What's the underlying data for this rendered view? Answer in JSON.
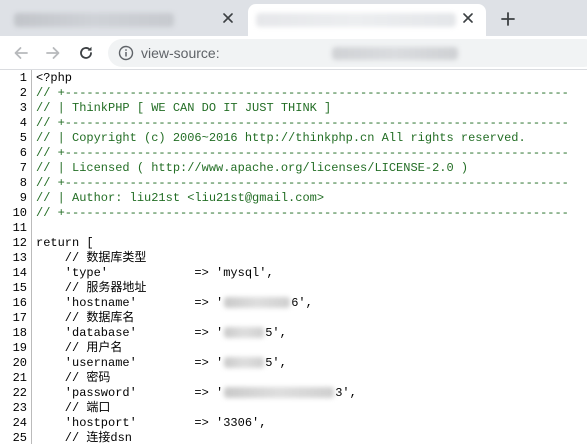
{
  "tabs": [
    {
      "title": "",
      "active": false
    },
    {
      "title": "",
      "active": true
    }
  ],
  "new_tab_symbol": "+",
  "close_symbol": "✕",
  "address_bar": {
    "url_visible": "view-source:"
  },
  "icons": {
    "back": "back-arrow-icon",
    "forward": "forward-arrow-icon",
    "reload": "reload-icon",
    "info": "info-icon"
  },
  "colors": {
    "comment": "#236e25",
    "text": "#000000",
    "tabbar": "#dee1e6",
    "omnibox": "#f1f3f4"
  },
  "source_lines": [
    {
      "num": "1",
      "comment": false,
      "segs": [
        "<?php"
      ]
    },
    {
      "num": "2",
      "comment": true,
      "segs": [
        "// +----------------------------------------------------------------------"
      ]
    },
    {
      "num": "3",
      "comment": true,
      "segs": [
        "// | ThinkPHP [ WE CAN DO IT JUST THINK ]"
      ]
    },
    {
      "num": "4",
      "comment": true,
      "segs": [
        "// +----------------------------------------------------------------------"
      ]
    },
    {
      "num": "5",
      "comment": true,
      "segs": [
        "// | Copyright (c) 2006~2016 http://thinkphp.cn All rights reserved."
      ]
    },
    {
      "num": "6",
      "comment": true,
      "segs": [
        "// +----------------------------------------------------------------------"
      ]
    },
    {
      "num": "7",
      "comment": true,
      "segs": [
        "// | Licensed ( http://www.apache.org/licenses/LICENSE-2.0 )"
      ]
    },
    {
      "num": "8",
      "comment": true,
      "segs": [
        "// +----------------------------------------------------------------------"
      ]
    },
    {
      "num": "9",
      "comment": true,
      "segs": [
        "// | Author: liu21st <liu21st@gmail.com>"
      ]
    },
    {
      "num": "10",
      "comment": true,
      "segs": [
        "// +----------------------------------------------------------------------"
      ]
    },
    {
      "num": "11",
      "comment": false,
      "segs": [
        ""
      ]
    },
    {
      "num": "12",
      "comment": false,
      "segs": [
        "return ["
      ]
    },
    {
      "num": "13",
      "comment": false,
      "segs": [
        "    // 数据库类型"
      ]
    },
    {
      "num": "14",
      "comment": false,
      "segs": [
        "    'type'            => 'mysql',"
      ]
    },
    {
      "num": "15",
      "comment": false,
      "segs": [
        "    // 服务器地址"
      ]
    },
    {
      "num": "16",
      "comment": false,
      "segs": [
        "    'hostname'        => '",
        {
          "redact": 66
        },
        "6',"
      ]
    },
    {
      "num": "17",
      "comment": false,
      "segs": [
        "    // 数据库名"
      ]
    },
    {
      "num": "18",
      "comment": false,
      "segs": [
        "    'database'        => '",
        {
          "redact": 40
        },
        "5',"
      ]
    },
    {
      "num": "19",
      "comment": false,
      "segs": [
        "    // 用户名"
      ]
    },
    {
      "num": "20",
      "comment": false,
      "segs": [
        "    'username'        => '",
        {
          "redact": 40
        },
        "5',"
      ]
    },
    {
      "num": "21",
      "comment": false,
      "segs": [
        "    // 密码"
      ]
    },
    {
      "num": "22",
      "comment": false,
      "segs": [
        "    'password'        => '",
        {
          "redact": 110
        },
        "3',"
      ]
    },
    {
      "num": "23",
      "comment": false,
      "segs": [
        "    // 端口"
      ]
    },
    {
      "num": "24",
      "comment": false,
      "segs": [
        "    'hostport'        => '3306',"
      ]
    },
    {
      "num": "25",
      "comment": false,
      "segs": [
        "    // 连接dsn"
      ]
    }
  ]
}
